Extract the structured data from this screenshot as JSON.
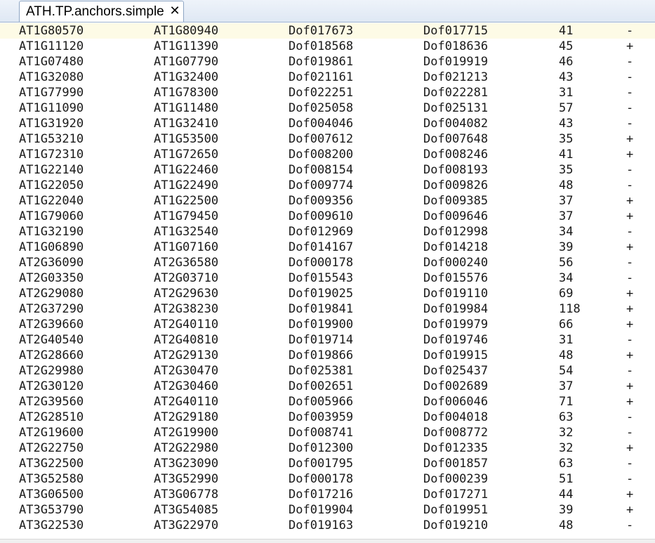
{
  "tab": {
    "title": "ATH.TP.anchors.simple",
    "close_glyph": "✕"
  },
  "rows": [
    [
      "AT1G80570",
      "AT1G80940",
      "Dof017673",
      "Dof017715",
      "41",
      "-"
    ],
    [
      "AT1G11120",
      "AT1G11390",
      "Dof018568",
      "Dof018636",
      "45",
      "+"
    ],
    [
      "AT1G07480",
      "AT1G07790",
      "Dof019861",
      "Dof019919",
      "46",
      "-"
    ],
    [
      "AT1G32080",
      "AT1G32400",
      "Dof021161",
      "Dof021213",
      "43",
      "-"
    ],
    [
      "AT1G77990",
      "AT1G78300",
      "Dof022251",
      "Dof022281",
      "31",
      "-"
    ],
    [
      "AT1G11090",
      "AT1G11480",
      "Dof025058",
      "Dof025131",
      "57",
      "-"
    ],
    [
      "AT1G31920",
      "AT1G32410",
      "Dof004046",
      "Dof004082",
      "43",
      "-"
    ],
    [
      "AT1G53210",
      "AT1G53500",
      "Dof007612",
      "Dof007648",
      "35",
      "+"
    ],
    [
      "AT1G72310",
      "AT1G72650",
      "Dof008200",
      "Dof008246",
      "41",
      "+"
    ],
    [
      "AT1G22140",
      "AT1G22460",
      "Dof008154",
      "Dof008193",
      "35",
      "-"
    ],
    [
      "AT1G22050",
      "AT1G22490",
      "Dof009774",
      "Dof009826",
      "48",
      "-"
    ],
    [
      "AT1G22040",
      "AT1G22500",
      "Dof009356",
      "Dof009385",
      "37",
      "+"
    ],
    [
      "AT1G79060",
      "AT1G79450",
      "Dof009610",
      "Dof009646",
      "37",
      "+"
    ],
    [
      "AT1G32190",
      "AT1G32540",
      "Dof012969",
      "Dof012998",
      "34",
      "-"
    ],
    [
      "AT1G06890",
      "AT1G07160",
      "Dof014167",
      "Dof014218",
      "39",
      "+"
    ],
    [
      "AT2G36090",
      "AT2G36580",
      "Dof000178",
      "Dof000240",
      "56",
      "-"
    ],
    [
      "AT2G03350",
      "AT2G03710",
      "Dof015543",
      "Dof015576",
      "34",
      "-"
    ],
    [
      "AT2G29080",
      "AT2G29630",
      "Dof019025",
      "Dof019110",
      "69",
      "+"
    ],
    [
      "AT2G37290",
      "AT2G38230",
      "Dof019841",
      "Dof019984",
      "118",
      "+"
    ],
    [
      "AT2G39660",
      "AT2G40110",
      "Dof019900",
      "Dof019979",
      "66",
      "+"
    ],
    [
      "AT2G40540",
      "AT2G40810",
      "Dof019714",
      "Dof019746",
      "31",
      "-"
    ],
    [
      "AT2G28660",
      "AT2G29130",
      "Dof019866",
      "Dof019915",
      "48",
      "+"
    ],
    [
      "AT2G29980",
      "AT2G30470",
      "Dof025381",
      "Dof025437",
      "54",
      "-"
    ],
    [
      "AT2G30120",
      "AT2G30460",
      "Dof002651",
      "Dof002689",
      "37",
      "+"
    ],
    [
      "AT2G39560",
      "AT2G40110",
      "Dof005966",
      "Dof006046",
      "71",
      "+"
    ],
    [
      "AT2G28510",
      "AT2G29180",
      "Dof003959",
      "Dof004018",
      "63",
      "-"
    ],
    [
      "AT2G19600",
      "AT2G19900",
      "Dof008741",
      "Dof008772",
      "32",
      "-"
    ],
    [
      "AT2G22750",
      "AT2G22980",
      "Dof012300",
      "Dof012335",
      "32",
      "+"
    ],
    [
      "AT3G22500",
      "AT3G23090",
      "Dof001795",
      "Dof001857",
      "63",
      "-"
    ],
    [
      "AT3G52580",
      "AT3G52990",
      "Dof000178",
      "Dof000239",
      "51",
      "-"
    ],
    [
      "AT3G06500",
      "AT3G06778",
      "Dof017216",
      "Dof017271",
      "44",
      "+"
    ],
    [
      "AT3G53790",
      "AT3G54085",
      "Dof019904",
      "Dof019951",
      "39",
      "+"
    ],
    [
      "AT3G22530",
      "AT3G22970",
      "Dof019163",
      "Dof019210",
      "48",
      "-"
    ]
  ]
}
